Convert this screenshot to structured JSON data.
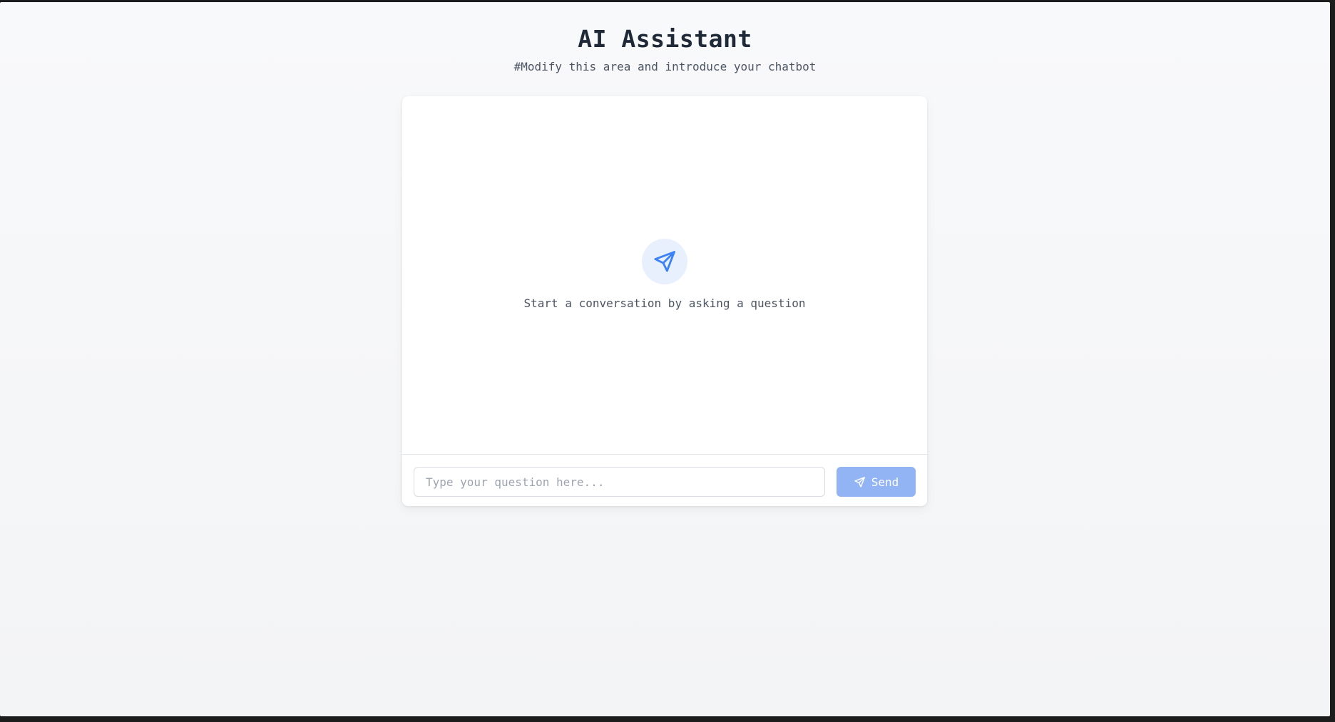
{
  "header": {
    "title": "AI Assistant",
    "subtitle": "#Modify this area and introduce your chatbot"
  },
  "chat": {
    "empty_state": {
      "icon": "send-icon",
      "text": "Start a conversation by asking a question"
    },
    "input": {
      "value": "",
      "placeholder": "Type your question here..."
    },
    "send_button": {
      "icon": "send-icon",
      "label": "Send"
    }
  },
  "colors": {
    "accent": "#3b82f6",
    "accent_light": "#e8f0fe",
    "button_disabled": "#93b4f4",
    "title_text": "#1f2937",
    "body_text": "#4b5563"
  }
}
